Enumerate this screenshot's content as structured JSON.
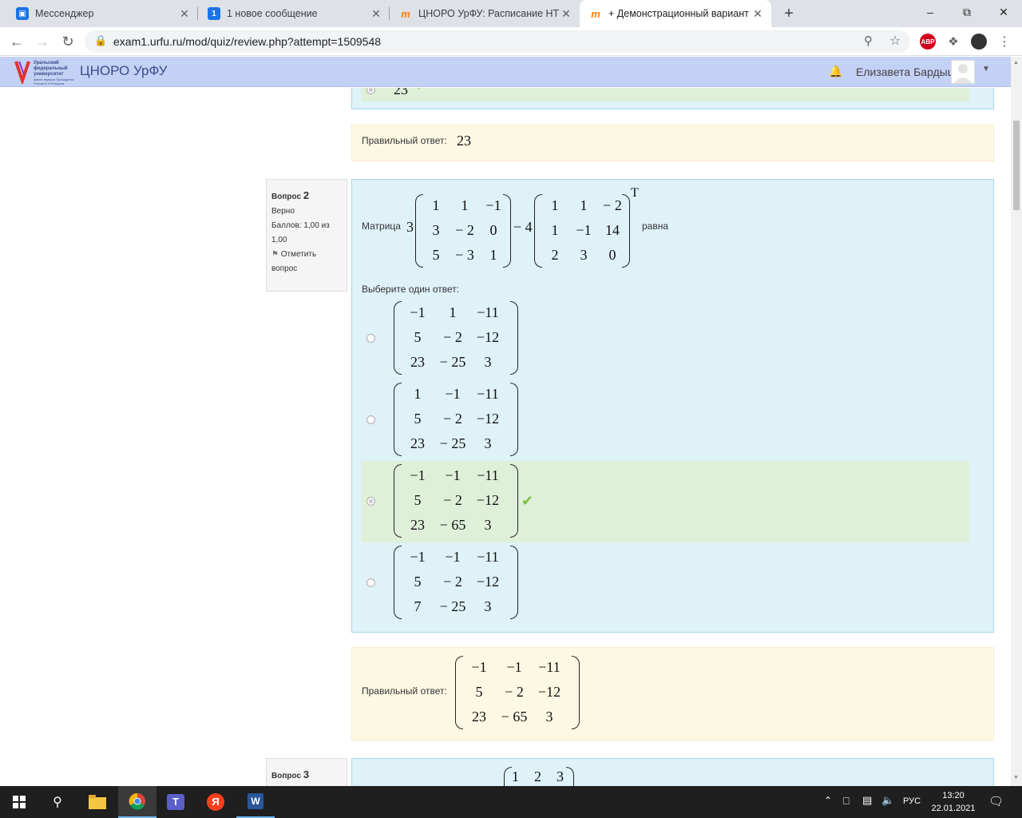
{
  "browser": {
    "tabs": [
      {
        "title": "Мессенджер",
        "icon": "messenger-icon",
        "active": false
      },
      {
        "title": "1 новое сообщение",
        "icon": "notification-icon",
        "badge": "1",
        "active": false
      },
      {
        "title": "ЦНОРО УрФУ: Расписание НТК",
        "icon": "moodle-icon",
        "active": false
      },
      {
        "title": "+ Демонстрационный вариант",
        "icon": "moodle-icon",
        "active": true
      }
    ],
    "url": "exam1.urfu.ru/mod/quiz/review.php?attempt=1509548",
    "new_tab_label": "+"
  },
  "site": {
    "logo_lines": [
      "Уральский",
      "федеральный",
      "университет",
      "имени первого Президента",
      "России Б.Н.Ельцина"
    ],
    "brand": "ЦНОРО УрФУ",
    "user_name": "Елизавета Бардыш"
  },
  "prev_question": {
    "visible_answer": "23",
    "correct_label": "Правильный ответ:",
    "correct_value": "23"
  },
  "question2": {
    "label": "Вопрос",
    "number": "2",
    "state": "Верно",
    "grade": "Баллов: 1,00 из 1,00",
    "flag": "Отметить вопрос",
    "prompt_prefix": "Матрица",
    "coef1": "3",
    "op": "− 4",
    "suffix": "равна",
    "transpose": "T",
    "matrixA": [
      [
        "1",
        "1",
        "−1"
      ],
      [
        "3",
        "− 2",
        "0"
      ],
      [
        "5",
        "− 3",
        "1"
      ]
    ],
    "matrixB": [
      [
        "1",
        "1",
        "− 2"
      ],
      [
        "1",
        "−1",
        "14"
      ],
      [
        "2",
        "3",
        "0"
      ]
    ],
    "choose": "Выберите один ответ:",
    "options": [
      {
        "m": [
          [
            "−1",
            "1",
            "−11"
          ],
          [
            "5",
            "− 2",
            "−12"
          ],
          [
            "23",
            "− 25",
            "3"
          ]
        ],
        "selected": false,
        "correct": false
      },
      {
        "m": [
          [
            "1",
            "−1",
            "−11"
          ],
          [
            "5",
            "− 2",
            "−12"
          ],
          [
            "23",
            "− 25",
            "3"
          ]
        ],
        "selected": false,
        "correct": false
      },
      {
        "m": [
          [
            "−1",
            "−1",
            "−11"
          ],
          [
            "5",
            "− 2",
            "−12"
          ],
          [
            "23",
            "− 65",
            "3"
          ]
        ],
        "selected": true,
        "correct": true
      },
      {
        "m": [
          [
            "−1",
            "−1",
            "−11"
          ],
          [
            "5",
            "− 2",
            "−12"
          ],
          [
            "7",
            "− 25",
            "3"
          ]
        ],
        "selected": false,
        "correct": false
      }
    ],
    "correct_label": "Правильный ответ:",
    "correct_matrix": [
      [
        "−1",
        "−1",
        "−11"
      ],
      [
        "5",
        "− 2",
        "−12"
      ],
      [
        "23",
        "− 65",
        "3"
      ]
    ]
  },
  "question3": {
    "label": "Вопрос",
    "number": "3",
    "matrix_first_row": [
      "1",
      "2",
      "3"
    ]
  },
  "taskbar": {
    "lang": "РУС",
    "time": "13:20",
    "date": "22.01.2021"
  }
}
